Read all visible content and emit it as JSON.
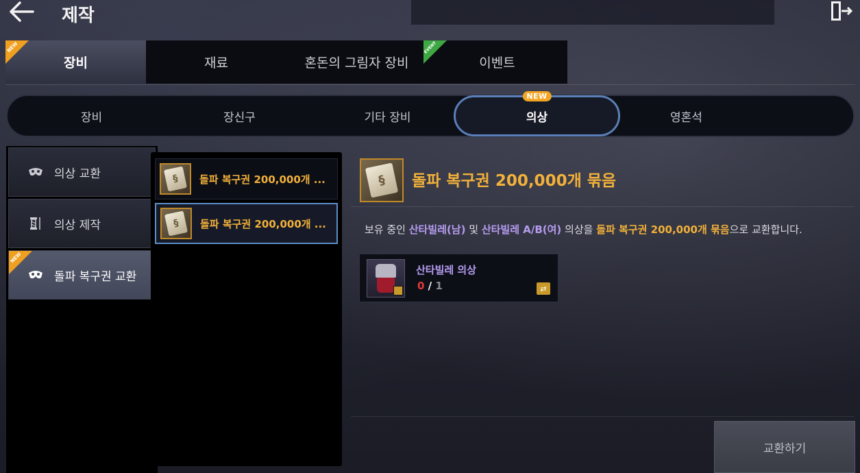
{
  "header": {
    "title": "제작",
    "back_icon": "arrow-left-icon",
    "exit_icon": "exit-door-icon"
  },
  "main_tabs": [
    {
      "label": "장비",
      "active": true,
      "badge": "NEW"
    },
    {
      "label": "재료",
      "active": false
    },
    {
      "label": "혼돈의 그림자 장비",
      "active": false
    },
    {
      "label": "이벤트",
      "active": false,
      "badge": "EVENT"
    }
  ],
  "sub_tabs": [
    {
      "label": "장비",
      "active": false
    },
    {
      "label": "장신구",
      "active": false
    },
    {
      "label": "기타 장비",
      "active": false
    },
    {
      "label": "의상",
      "active": true,
      "badge": "NEW"
    },
    {
      "label": "영혼석",
      "active": false
    }
  ],
  "categories": [
    {
      "label": "의상 교환",
      "icon": "mask-icon",
      "active": false
    },
    {
      "label": "의상 제작",
      "icon": "spool-needle-icon",
      "active": false
    },
    {
      "label": "돌파 복구권 교환",
      "icon": "mask-icon",
      "active": true,
      "badge": "NEW"
    }
  ],
  "recipes": [
    {
      "label": "돌파 복구권 200,000개 ...",
      "selected": false
    },
    {
      "label": "돌파 복구권 200,000개 ...",
      "selected": true
    }
  ],
  "detail": {
    "title": "돌파 복구권 200,000개 묶음",
    "description": {
      "p1": "보유 중인 ",
      "p2": "산타빌레(남)",
      "p3": " 및 ",
      "p4": "산타빌레 A/B(여)",
      "p5": " 의상을 ",
      "p6": "돌파 복구권 200,000개 묶음",
      "p7": "으로 교환합니다."
    },
    "requirement": {
      "name": "산타빌레 의상",
      "have": "0",
      "separator": "/",
      "need": "1"
    },
    "exchange_button": "교환하기"
  },
  "colors": {
    "gold": "#f2b13a",
    "purple": "#b69cf0",
    "selected_border": "#5c8fc8",
    "new_badge": "#f3a623",
    "event_badge": "#3ea842"
  }
}
